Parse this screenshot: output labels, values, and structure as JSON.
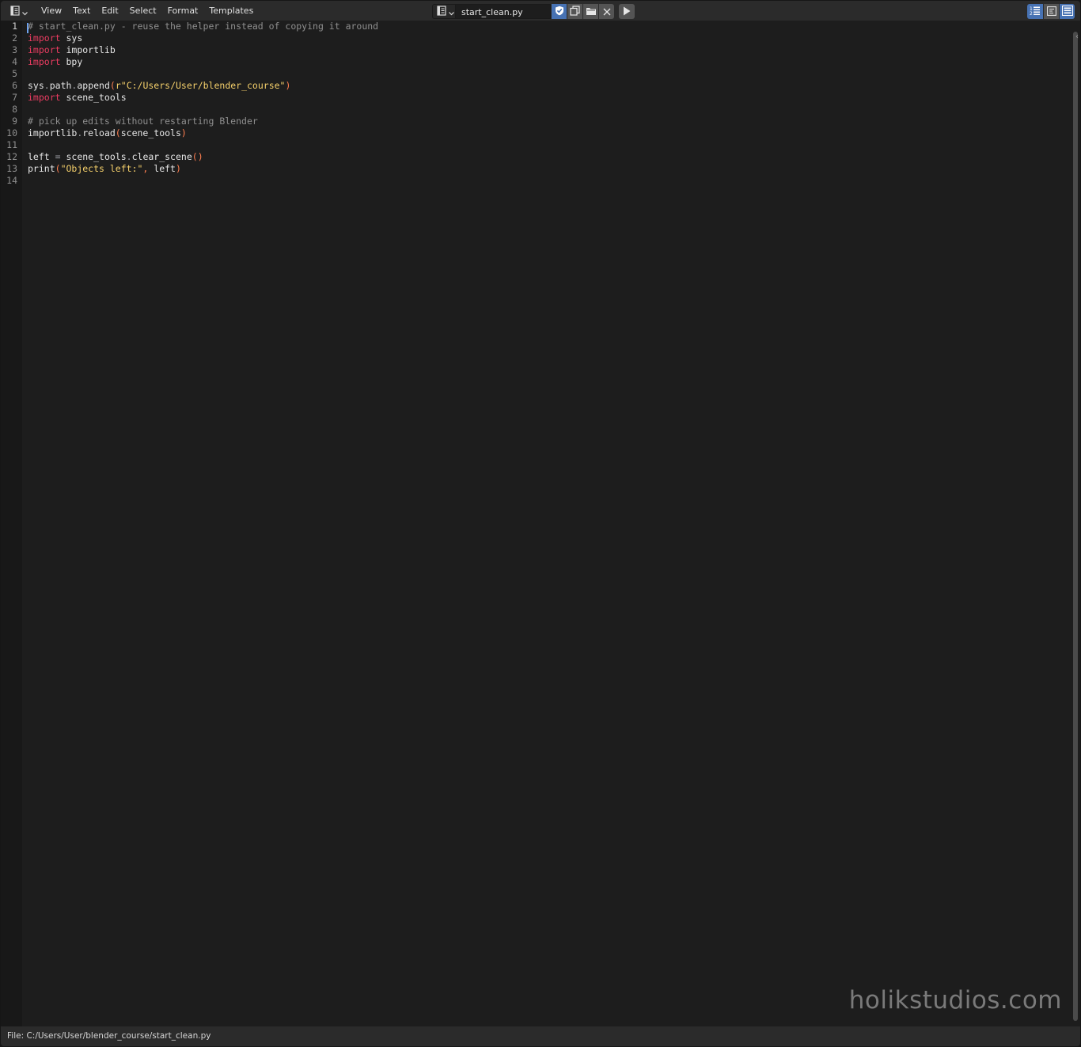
{
  "header": {
    "editor_type_icon": "text-editor-icon",
    "menu": [
      "View",
      "Text",
      "Edit",
      "Select",
      "Format",
      "Templates"
    ],
    "datablock": {
      "type_icon": "text-datablock-icon",
      "name": "start_clean.py",
      "fake_user_icon": "shield-icon",
      "new_icon": "duplicate-icon",
      "open_icon": "folder-icon",
      "unlink_icon": "close-icon"
    },
    "run_icon": "play-icon",
    "toggles": [
      "line-numbers-icon",
      "word-wrap-icon",
      "syntax-highlight-icon"
    ]
  },
  "editor": {
    "line_numbers": [
      "1",
      "2",
      "3",
      "4",
      "5",
      "6",
      "7",
      "8",
      "9",
      "10",
      "11",
      "12",
      "13",
      "14"
    ],
    "current_line": 1,
    "lines": [
      [
        {
          "t": "# start_clean.py - reuse the helper instead of copying it around",
          "c": "c"
        }
      ],
      [
        {
          "t": "import",
          "c": "k"
        },
        {
          "t": " sys",
          "c": "t"
        }
      ],
      [
        {
          "t": "import",
          "c": "k"
        },
        {
          "t": " importlib",
          "c": "t"
        }
      ],
      [
        {
          "t": "import",
          "c": "k"
        },
        {
          "t": " bpy",
          "c": "t"
        }
      ],
      [],
      [
        {
          "t": "sys",
          "c": "t"
        },
        {
          "t": ".",
          "c": "o"
        },
        {
          "t": "path",
          "c": "t"
        },
        {
          "t": ".",
          "c": "o"
        },
        {
          "t": "append",
          "c": "t"
        },
        {
          "t": "(",
          "c": "p"
        },
        {
          "t": "r\"C:/Users/User/blender_course\"",
          "c": "s"
        },
        {
          "t": ")",
          "c": "p"
        }
      ],
      [
        {
          "t": "import",
          "c": "k"
        },
        {
          "t": " scene_tools",
          "c": "t"
        }
      ],
      [],
      [
        {
          "t": "# pick up edits without restarting Blender",
          "c": "c"
        }
      ],
      [
        {
          "t": "importlib",
          "c": "t"
        },
        {
          "t": ".",
          "c": "o"
        },
        {
          "t": "reload",
          "c": "t"
        },
        {
          "t": "(",
          "c": "p"
        },
        {
          "t": "scene_tools",
          "c": "t"
        },
        {
          "t": ")",
          "c": "p"
        }
      ],
      [],
      [
        {
          "t": "left ",
          "c": "t"
        },
        {
          "t": "=",
          "c": "o"
        },
        {
          "t": " scene_tools",
          "c": "t"
        },
        {
          "t": ".",
          "c": "o"
        },
        {
          "t": "clear_scene",
          "c": "t"
        },
        {
          "t": "()",
          "c": "p"
        }
      ],
      [
        {
          "t": "print",
          "c": "t"
        },
        {
          "t": "(",
          "c": "p"
        },
        {
          "t": "\"Objects left:\"",
          "c": "s"
        },
        {
          "t": ",",
          "c": "p"
        },
        {
          "t": " left",
          "c": "t"
        },
        {
          "t": ")",
          "c": "p"
        }
      ],
      []
    ],
    "colors": {
      "comment": "#8f8f8f",
      "keyword": "#eb3c61",
      "string": "#f5d06b",
      "punctuation": "#ff7f50",
      "text": "#e6e6e6"
    }
  },
  "watermark": "holikstudios.com",
  "footer": {
    "status": "File: C:/Users/User/blender_course/start_clean.py"
  }
}
